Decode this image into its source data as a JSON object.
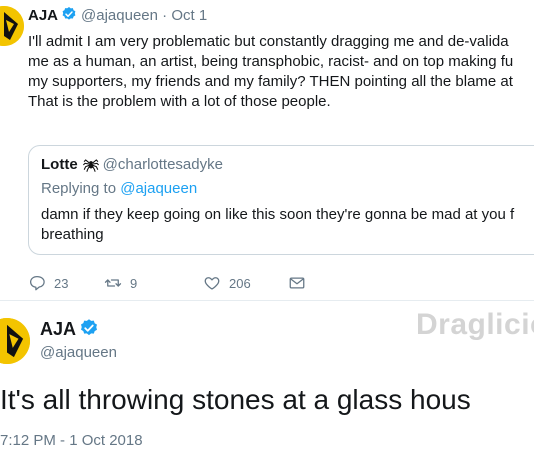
{
  "tweet": {
    "author_name": "AJA",
    "handle": "@ajaqueen",
    "separator": "·",
    "date": "Oct 1",
    "body_lines": [
      "I'll admit I am very problematic but constantly dragging me and de-valida",
      "me as a human, an artist, being transphobic, racist- and on top making fu",
      "my supporters, my friends and my family? THEN pointing all the blame at",
      "That is the problem with a lot of those people."
    ],
    "quote": {
      "author_name": "Lotte",
      "author_icon": "spider-icon",
      "handle": "@charlottesadyke",
      "replying_prefix": "Replying to",
      "replying_to": "@ajaqueen",
      "body_lines": [
        "damn if they keep going on like this soon they're gonna be mad at you f",
        "breathing"
      ]
    },
    "actions": {
      "replies": "23",
      "retweets": "9",
      "likes": "206"
    }
  },
  "tweet2": {
    "author_name": "AJA",
    "handle": "@ajaqueen",
    "text": "It's all throwing stones at a glass hous",
    "timestamp": "7:12 PM - 1 Oct 2018"
  },
  "watermark": "Draglicio",
  "colors": {
    "verified": "#1da1f2",
    "secondary_text": "#657786",
    "avatar_bg": "#f3c400"
  }
}
